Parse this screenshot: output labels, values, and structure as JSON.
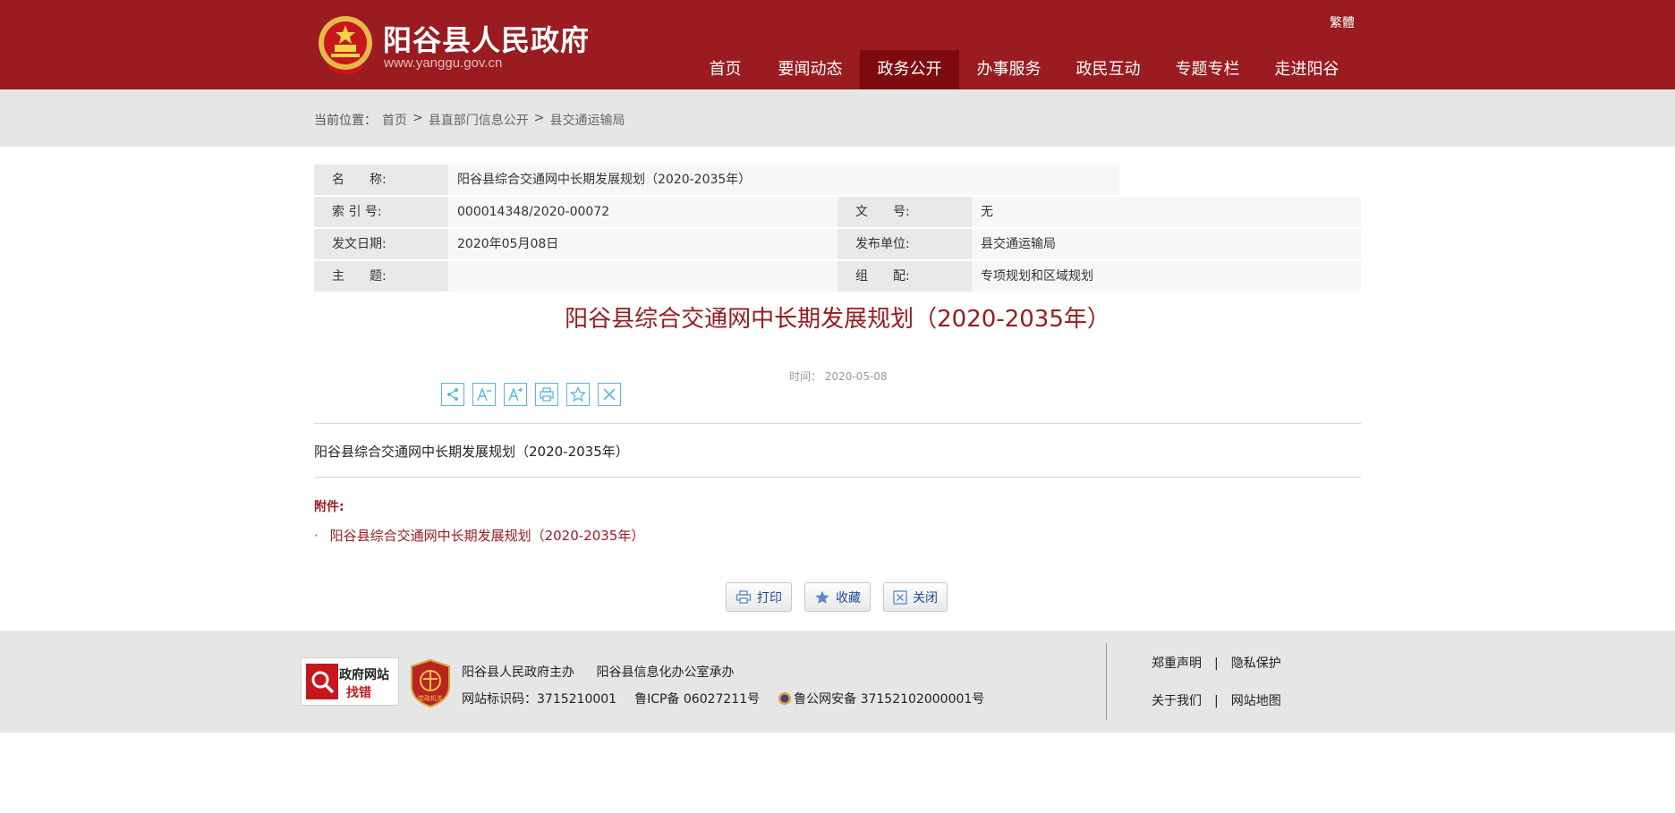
{
  "header": {
    "site_title": "阳谷县人民政府",
    "site_domain": "www.yanggu.gov.cn",
    "lang_switch": "繁體",
    "nav": [
      {
        "label": "首页",
        "active": false
      },
      {
        "label": "要闻动态",
        "active": false
      },
      {
        "label": "政务公开",
        "active": true
      },
      {
        "label": "办事服务",
        "active": false
      },
      {
        "label": "政民互动",
        "active": false
      },
      {
        "label": "专题专栏",
        "active": false
      },
      {
        "label": "走进阳谷",
        "active": false
      }
    ]
  },
  "breadcrumb": {
    "prefix": "当前位置：",
    "items": [
      "首页",
      "县直部门信息公开",
      "县交通运输局"
    ],
    "separator": ">"
  },
  "info": {
    "name_label": "名　　称:",
    "name_value": "阳谷县综合交通网中长期发展规划（2020-2035年）",
    "index_label": "索 引 号:",
    "index_value": "000014348/2020-00072",
    "docno_label": "文　　号:",
    "docno_value": "无",
    "date_label": "发文日期:",
    "date_value": "2020年05月08日",
    "org_label": "发布单位:",
    "org_value": "县交通运输局",
    "topic_label": "主　　题:",
    "topic_value": "",
    "category_label": "组　　配:",
    "category_value": "专项规划和区域规划"
  },
  "article": {
    "title": "阳谷县综合交通网中长期发展规划（2020-2035年）",
    "time": "时间：  2020-05-08",
    "body": "阳谷县综合交通网中长期发展规划（2020-2035年）",
    "attachment_label": "附件:",
    "attachment_dot": "·",
    "attachment": "阳谷县综合交通网中长期发展规划（2020-2035年）"
  },
  "tools": [
    "share-icon",
    "font-decrease-icon",
    "font-increase-icon",
    "print-icon",
    "star-icon",
    "close-icon"
  ],
  "buttons": {
    "print": "打印",
    "favorite": "收藏",
    "close": "关闭"
  },
  "footer": {
    "jiucuo_line1": "政府网站",
    "jiucuo_line2": "找错",
    "badge_text": "党政机关",
    "sponsor": "阳谷县人民政府主办",
    "organizer": "阳谷县信息化办公室承办",
    "site_id": "网站标识码：3715210001",
    "icp": "鲁ICP备 06027211号",
    "police": "鲁公网安备 37152102000001号",
    "statement": "郑重声明",
    "privacy": "隐私保护",
    "about": "关于我们",
    "sitemap": "网站地图",
    "divider": "|"
  },
  "colors": {
    "brand_red": "#9a1b20",
    "nav_active": "#7c0a0e",
    "tool_blue": "#5ab4dd"
  }
}
